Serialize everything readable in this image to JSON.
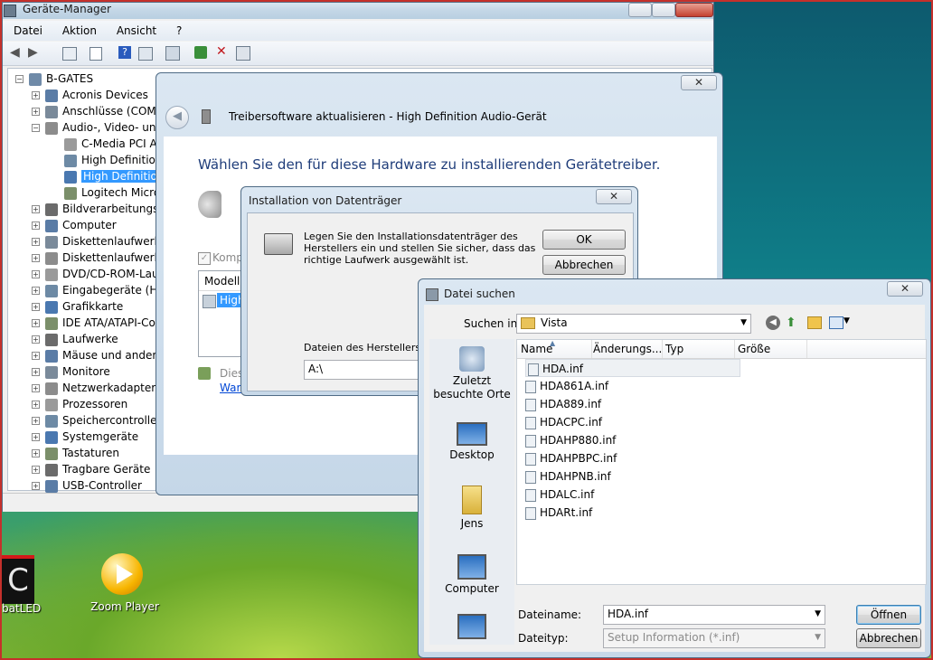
{
  "device_manager": {
    "title": "Geräte-Manager",
    "menu": [
      "Datei",
      "Aktion",
      "Ansicht",
      "?"
    ],
    "root": "B-GATES",
    "tree": [
      {
        "label": "Acronis Devices",
        "level": 1,
        "exp": "+"
      },
      {
        "label": "Anschlüsse (COM &",
        "level": 1,
        "exp": "+"
      },
      {
        "label": "Audio-, Video- und",
        "level": 1,
        "exp": "-"
      },
      {
        "label": "C-Media PCI Au",
        "level": 2,
        "exp": ""
      },
      {
        "label": "High Definition",
        "level": 2,
        "exp": ""
      },
      {
        "label": "High Definition",
        "level": 2,
        "exp": "",
        "selected": true
      },
      {
        "label": "Logitech Microp",
        "level": 2,
        "exp": ""
      },
      {
        "label": "Bildverarbeitungsge",
        "level": 1,
        "exp": "+"
      },
      {
        "label": "Computer",
        "level": 1,
        "exp": "+"
      },
      {
        "label": "Diskettenlaufwerkco",
        "level": 1,
        "exp": "+"
      },
      {
        "label": "Diskettenlaufwerke",
        "level": 1,
        "exp": "+"
      },
      {
        "label": "DVD/CD-ROM-Lauf",
        "level": 1,
        "exp": "+"
      },
      {
        "label": "Eingabegeräte (Hun",
        "level": 1,
        "exp": "+"
      },
      {
        "label": "Grafikkarte",
        "level": 1,
        "exp": "+"
      },
      {
        "label": "IDE ATA/ATAPI-Co",
        "level": 1,
        "exp": "+"
      },
      {
        "label": "Laufwerke",
        "level": 1,
        "exp": "+"
      },
      {
        "label": "Mäuse und andere",
        "level": 1,
        "exp": "+"
      },
      {
        "label": "Monitore",
        "level": 1,
        "exp": "+"
      },
      {
        "label": "Netzwerkadapter",
        "level": 1,
        "exp": "+"
      },
      {
        "label": "Prozessoren",
        "level": 1,
        "exp": "+"
      },
      {
        "label": "Speichercontroller",
        "level": 1,
        "exp": "+"
      },
      {
        "label": "Systemgeräte",
        "level": 1,
        "exp": "+"
      },
      {
        "label": "Tastaturen",
        "level": 1,
        "exp": "+"
      },
      {
        "label": "Tragbare Geräte",
        "level": 1,
        "exp": "+"
      },
      {
        "label": "USB-Controller",
        "level": 1,
        "exp": "+"
      }
    ]
  },
  "wizard": {
    "title": "Treibersoftware aktualisieren - High Definition Audio-Gerät",
    "heading": "Wählen Sie den für diese Hardware zu installierenden Gerätetreiber.",
    "compat_label": "Kompat",
    "model_header": "Modell",
    "model_item": "High",
    "signed_text": "Diese",
    "why_link": "Waru"
  },
  "install_disk": {
    "title": "Installation von Datenträger",
    "message": "Legen Sie den Installationsdatenträger des Herstellers ein und stellen Sie sicher, dass das richtige Laufwerk ausgewählt ist.",
    "ok": "OK",
    "cancel": "Abbrechen",
    "copy_label": "Dateien des Herstellers kop",
    "path": "A:\\"
  },
  "file_dialog": {
    "title": "Datei suchen",
    "look_in_label": "Suchen in:",
    "look_in_value": "Vista",
    "columns": [
      "Name",
      "Änderungs...",
      "Typ",
      "Größe"
    ],
    "places": [
      "Zuletzt besuchte Orte",
      "Desktop",
      "Jens",
      "Computer"
    ],
    "files": [
      "HDA.inf",
      "HDA861A.inf",
      "HDA889.inf",
      "HDACPC.inf",
      "HDAHP880.inf",
      "HDAHPBPC.inf",
      "HDAHPNB.inf",
      "HDALC.inf",
      "HDARt.inf"
    ],
    "filename_label": "Dateiname:",
    "filename_value": "HDA.inf",
    "filetype_label": "Dateityp:",
    "filetype_value": "Setup Information (*.inf)",
    "open": "Öffnen",
    "cancel": "Abbrechen",
    "close": "X"
  },
  "desktop": {
    "icons": [
      {
        "label": "batLED"
      },
      {
        "label": "Zoom Player"
      }
    ]
  },
  "colors": {
    "selection": "#3399ff",
    "heading_blue": "#1f3d7a",
    "link_blue": "#0046d5"
  }
}
